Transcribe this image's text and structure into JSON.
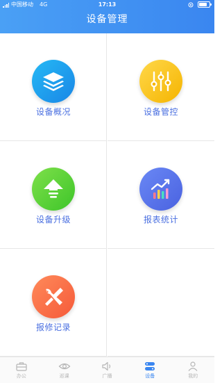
{
  "status_bar": {
    "carrier": "中国移动",
    "network": "4G",
    "time": "17:13",
    "battery_percent": 80
  },
  "header": {
    "title": "设备管理"
  },
  "grid": {
    "items": [
      {
        "label": "设备概况",
        "icon": "layers-icon",
        "color_from": "#25b9f5",
        "color_to": "#1a86e6"
      },
      {
        "label": "设备管控",
        "icon": "sliders-icon",
        "color_from": "#ffd84a",
        "color_to": "#f5b400"
      },
      {
        "label": "设备升级",
        "icon": "upgrade-arrow-icon",
        "color_from": "#7ee04a",
        "color_to": "#3ec52a"
      },
      {
        "label": "报表统计",
        "icon": "bar-chart-icon",
        "color_from": "#6a88f5",
        "color_to": "#4a62e0"
      },
      {
        "label": "报修记录",
        "icon": "repair-tools-icon",
        "color_from": "#ff8a5a",
        "color_to": "#f55a3a"
      }
    ]
  },
  "tabbar": {
    "tabs": [
      {
        "label": "办公",
        "icon": "briefcase-icon",
        "active": false
      },
      {
        "label": "巡课",
        "icon": "eye-icon",
        "active": false
      },
      {
        "label": "广播",
        "icon": "speaker-icon",
        "active": false
      },
      {
        "label": "设备",
        "icon": "device-icon",
        "active": true
      },
      {
        "label": "我的",
        "icon": "user-icon",
        "active": false
      }
    ]
  },
  "colors": {
    "header_start": "#4aa0f5",
    "header_end": "#3a86f0",
    "label_text": "#4a6fe0",
    "tab_inactive": "#b5b5b5",
    "tab_active": "#3a86f0"
  }
}
